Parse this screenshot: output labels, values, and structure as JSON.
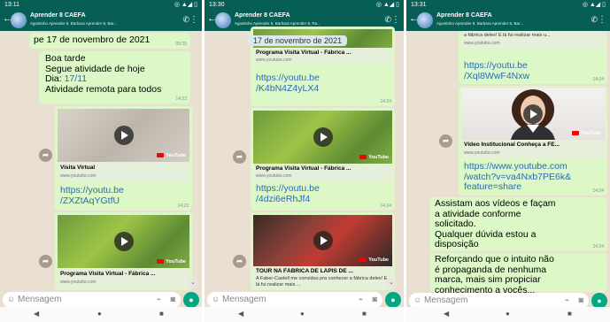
{
  "panels": [
    {
      "status_time": "13:11",
      "status_icons": "◎ ▲◢ ▯",
      "chat_title": "Aprender 8 CAEFA",
      "chat_subtitle": "Agostinho Aprender 8, Barbara Aprender 8, Bar...",
      "date_msg": {
        "text": "pe 17 de novembro de 2021",
        "time": "09:25"
      },
      "text_msg": {
        "lines": [
          "Boa tarde",
          "Segue atividade de hoje",
          "Dia: ",
          "17/11",
          "Atividade remota para todos"
        ],
        "time": "14:23"
      },
      "video1": {
        "title": "Visita Virtual",
        "site": "www.youtube.com",
        "link": [
          "https://youtu.be",
          "/ZXZtAqYGtfU"
        ],
        "time": "14:23"
      },
      "video2": {
        "title": "Programa Visita Virtual - Fábrica ...",
        "site": "www.youtube.com"
      },
      "input_placeholder": "Mensagem"
    },
    {
      "status_time": "13:30",
      "status_icons": "◎ ▲◢ ▯",
      "chat_title": "Aprender 8 CAEFA",
      "chat_subtitle": "Agostinho Aprender 8, Barbara Aprender 8, Ra...",
      "date_chip": "17 de novembro de 2021",
      "video1": {
        "title": "Programa Visita Virtual - Fábrica ...",
        "site": "www.youtube.com",
        "link": [
          "https://youtu.be",
          "/K4bN4Z4yLX4"
        ],
        "time": "14:24"
      },
      "video2": {
        "title": "Programa Visita Virtual - Fábrica ...",
        "site": "www.youtube.com",
        "link": [
          "https://youtu.be",
          "/4dzi6eRhJf4"
        ],
        "time": "14:24"
      },
      "video3": {
        "title": "TOUR NA FÁBRICA DE LÁPIS DE ...",
        "desc": "A Faber-Castell me convidou pra conhecer a fábrica deles! E lá fui realizar mais ..."
      },
      "input_placeholder": "Mensagem"
    },
    {
      "status_time": "13:31",
      "status_icons": "◎ ▲◢ ▯",
      "chat_title": "Aprender 8 CAEFA",
      "chat_subtitle": "Agostinho Aprender 8, Barbara Aprender 8, Bar...",
      "top_desc": "a fábrica deles! E lá fui realizar mais u...",
      "top_site": "www.youtube.com",
      "link_top": [
        "https://youtu.be",
        "/Xql8WwF4Nxw"
      ],
      "link_top_time": "14:24",
      "video": {
        "title": "Vídeo Institucional Conheça a FE...",
        "site": "www.youtube.com",
        "link": [
          "https://www.youtube.com",
          "/watch?v=va4Nxb7PE6k&",
          "feature=share"
        ],
        "time": "14:24"
      },
      "msg1": {
        "lines": [
          "Assistam aos vídeos e façam",
          "a atividade conforme",
          "solicitado.",
          "Qualquer dúvida estou a",
          "disposição"
        ],
        "time": "14:24"
      },
      "msg2": {
        "lines": [
          "Reforçando que o intuito não",
          "é propaganda de nenhuma",
          "marca, mais sim propiciar",
          "conhecimento a vocês..."
        ]
      },
      "input_placeholder": "Mensagem"
    }
  ],
  "colors": {
    "header": "#075e54",
    "bubble": "#dcf8c6",
    "chat_bg": "#e9e0d1",
    "link": "#2a69b8",
    "mic": "#00a884"
  },
  "icons": [
    "back-arrow-icon",
    "group-avatar-icon",
    "add-call-icon",
    "overflow-menu-icon",
    "play-icon",
    "youtube-logo-icon",
    "forward-icon",
    "emoji-icon",
    "attach-icon",
    "camera-icon",
    "mic-icon",
    "scroll-down-icon",
    "nav-back-icon",
    "nav-home-icon",
    "nav-recents-icon"
  ]
}
